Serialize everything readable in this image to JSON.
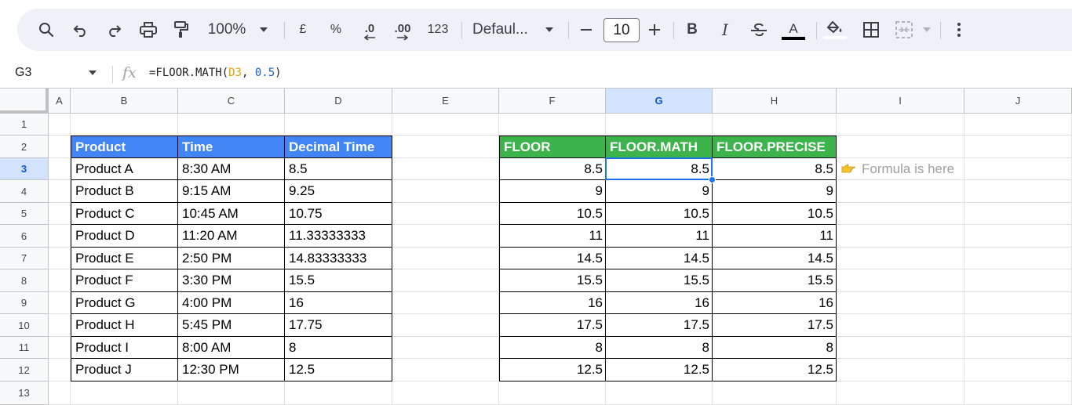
{
  "toolbar": {
    "zoom": "100%",
    "currency": "£",
    "percent": "%",
    "decrease_decimal": ".0",
    "increase_decimal": ".00",
    "number_format": "123",
    "font": "Defaul...",
    "font_size": "10",
    "bold": "B",
    "italic": "I",
    "text_color_letter": "A"
  },
  "formula_bar": {
    "cell_ref": "G3",
    "fx": "fx",
    "formula_prefix": "=FLOOR.MATH(",
    "formula_ref": "D3",
    "formula_sep": ", ",
    "formula_num": "0.5",
    "formula_suffix": ")"
  },
  "columns": [
    "A",
    "B",
    "C",
    "D",
    "E",
    "F",
    "G",
    "H",
    "I",
    "J"
  ],
  "selected_column": "G",
  "rows": [
    "1",
    "2",
    "3",
    "4",
    "5",
    "6",
    "7",
    "8",
    "9",
    "10",
    "11",
    "12",
    "13"
  ],
  "selected_row": "3",
  "left_table": {
    "headers": [
      "Product",
      "Time",
      "Decimal Time"
    ],
    "rows": [
      [
        "Product A",
        "8:30 AM",
        "8.5"
      ],
      [
        "Product B",
        "9:15 AM",
        "9.25"
      ],
      [
        "Product C",
        "10:45 AM",
        "10.75"
      ],
      [
        "Product D",
        "11:20 AM",
        "11.33333333"
      ],
      [
        "Product E",
        "2:50 PM",
        "14.83333333"
      ],
      [
        "Product F",
        "3:30 PM",
        "15.5"
      ],
      [
        "Product G",
        "4:00 PM",
        "16"
      ],
      [
        "Product H",
        "5:45 PM",
        "17.75"
      ],
      [
        "Product I",
        "8:00 AM",
        "8"
      ],
      [
        "Product J",
        "12:30 PM",
        "12.5"
      ]
    ]
  },
  "right_table": {
    "headers": [
      "FLOOR",
      "FLOOR.MATH",
      "FLOOR.PRECISE"
    ],
    "rows": [
      [
        "8.5",
        "8.5",
        "8.5"
      ],
      [
        "9",
        "9",
        "9"
      ],
      [
        "10.5",
        "10.5",
        "10.5"
      ],
      [
        "11",
        "11",
        "11"
      ],
      [
        "14.5",
        "14.5",
        "14.5"
      ],
      [
        "15.5",
        "15.5",
        "15.5"
      ],
      [
        "16",
        "16",
        "16"
      ],
      [
        "17.5",
        "17.5",
        "17.5"
      ],
      [
        "8",
        "8",
        "8"
      ],
      [
        "12.5",
        "12.5",
        "12.5"
      ]
    ]
  },
  "annotation": {
    "text": "Formula is here",
    "icon": "pointing-hand-icon"
  },
  "colors": {
    "blue_header": "#4285f4",
    "green_header": "#3cb44b",
    "selection": "#1a73e8"
  }
}
